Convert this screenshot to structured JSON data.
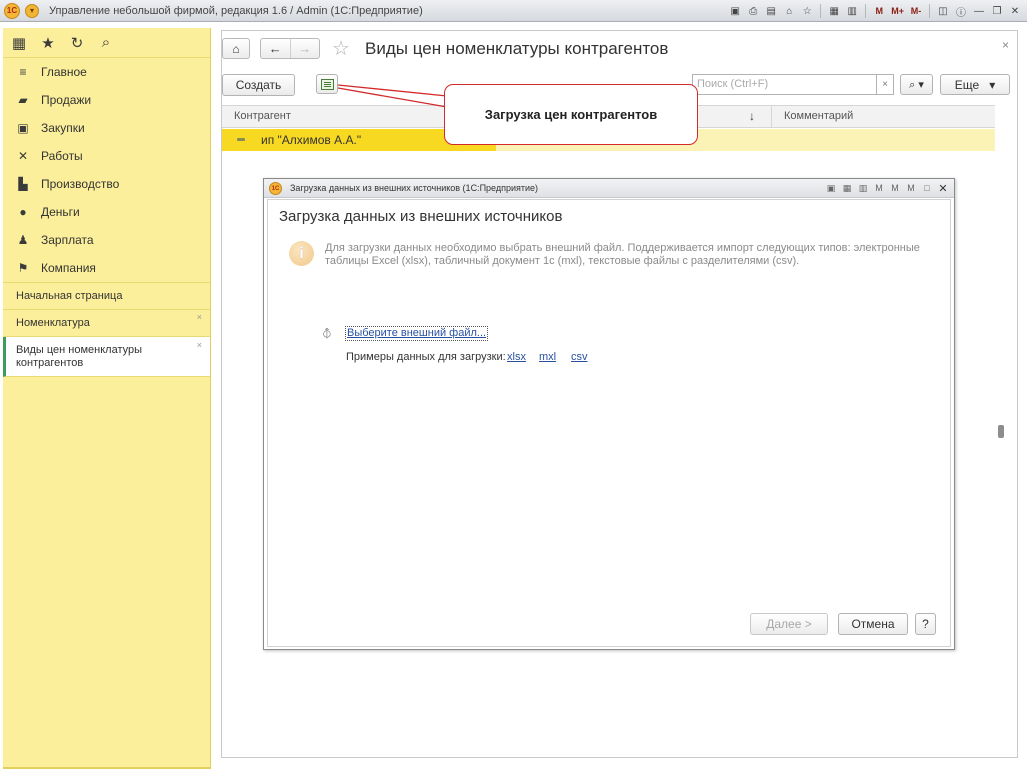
{
  "window": {
    "title": "Управление небольшой фирмой, редакция 1.6 / Admin  (1С:Предприятие)",
    "logo_text": "1С",
    "memory_buttons": [
      "M",
      "M+",
      "M-"
    ]
  },
  "sidebar": {
    "sections": [
      {
        "label": "Главное",
        "icon": "menu-lines-icon"
      },
      {
        "label": "Продажи",
        "icon": "shopping-bag-icon"
      },
      {
        "label": "Закупки",
        "icon": "purchases-icon"
      },
      {
        "label": "Работы",
        "icon": "tools-icon"
      },
      {
        "label": "Производство",
        "icon": "factory-icon"
      },
      {
        "label": "Деньги",
        "icon": "ruble-coin-icon"
      },
      {
        "label": "Зарплата",
        "icon": "people-icon"
      },
      {
        "label": "Компания",
        "icon": "flag-icon"
      }
    ],
    "open_windows": [
      {
        "label": "Начальная страница"
      },
      {
        "label": "Номенклатура"
      },
      {
        "label": "Виды цен номенклатуры контрагентов"
      }
    ]
  },
  "form": {
    "title": "Виды цен номенклатуры контрагентов",
    "create_label": "Создать",
    "search_placeholder": "Поиск (Ctrl+F)",
    "more_label": "Еще",
    "columns": [
      "Контрагент",
      "Комментарий"
    ],
    "rows": [
      {
        "counterparty": "ип \"Алхимов А.А.\"",
        "comment": ""
      }
    ]
  },
  "callout": {
    "text": "Загрузка цен контрагентов"
  },
  "dialog": {
    "window_title": "Загрузка данных из внешних источников  (1С:Предприятие)",
    "heading": "Загрузка данных из внешних источников",
    "info_text": "Для загрузки данных необходимо выбрать внешний файл. Поддерживается импорт следующих типов: электронные таблицы Excel (xlsx), табличный документ 1с (mxl), текстовые файлы с разделителями (csv).",
    "choose_file_link": "Выберите внешний файл...",
    "samples_label": "Примеры данных для загрузки:",
    "samples": [
      "xlsx",
      "mxl",
      "csv"
    ],
    "next_label": "Далее >",
    "cancel_label": "Отмена",
    "help_label": "?"
  }
}
